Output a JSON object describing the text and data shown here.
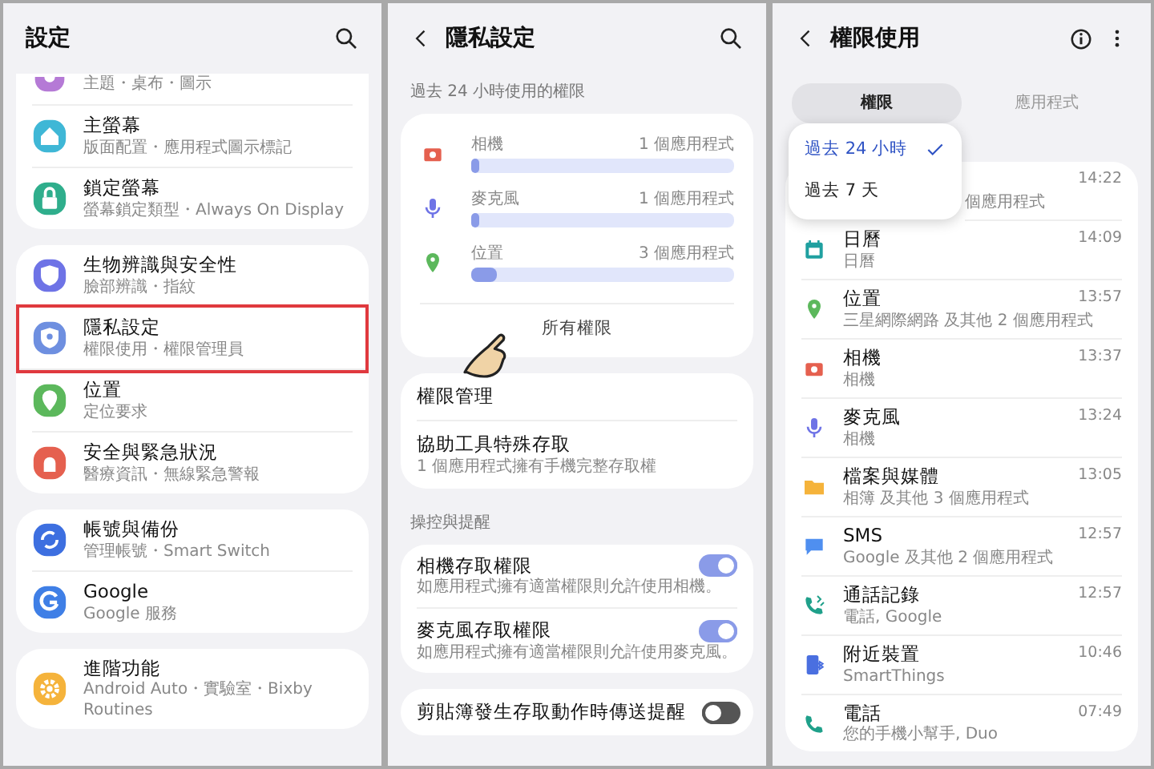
{
  "screens": [
    {
      "kind": "settings",
      "title": "設定",
      "groups": [
        {
          "items": [
            {
              "subtitle": "主題・桌布・圖示",
              "color": "#b57ad6",
              "highlighted": false
            },
            {
              "title": "主螢幕",
              "subtitle": "版面配置・應用程式圖示標記",
              "color": "#3fb7d6",
              "highlighted": false
            },
            {
              "title": "鎖定螢幕",
              "subtitle": "螢幕鎖定類型・Always On Display",
              "color": "#2fae8c",
              "highlighted": false
            }
          ]
        },
        {
          "items": [
            {
              "title": "生物辨識與安全性",
              "subtitle": "臉部辨識・指紋",
              "color": "#6e73e6",
              "highlighted": false
            },
            {
              "title": "隱私設定",
              "subtitle": "權限使用・權限管理員",
              "color": "#6e8fe0",
              "highlighted": true
            },
            {
              "title": "位置",
              "subtitle": "定位要求",
              "color": "#5cb85c",
              "highlighted": false
            },
            {
              "title": "安全與緊急狀況",
              "subtitle": "醫療資訊・無線緊急警報",
              "color": "#e5604f",
              "highlighted": false
            }
          ]
        },
        {
          "items": [
            {
              "title": "帳號與備份",
              "subtitle": "管理帳號・Smart Switch",
              "color": "#3d6fe0",
              "highlighted": false
            },
            {
              "title": "Google",
              "subtitle": "Google 服務",
              "color": "#3f7fe6",
              "highlighted": false
            }
          ]
        },
        {
          "items": [
            {
              "title": "進階功能",
              "subtitle": "Android Auto・實驗室・Bixby Routines",
              "color": "#f5b33b",
              "highlighted": false
            }
          ]
        }
      ]
    },
    {
      "kind": "privacy",
      "title": "隱私設定",
      "usage_label": "過去 24 小時使用的權限",
      "usage": [
        {
          "name": "相機",
          "count": "1 個應用程式",
          "level": 0.03,
          "color": "#e5604f"
        },
        {
          "name": "麥克風",
          "count": "1 個應用程式",
          "level": 0.03,
          "color": "#6e73e6"
        },
        {
          "name": "位置",
          "count": "3 個應用程式",
          "level": 0.1,
          "color": "#5cb85c"
        }
      ],
      "all_link": "所有權限",
      "manage_items": [
        {
          "title": "權限管理"
        },
        {
          "title": "協助工具特殊存取",
          "subtitle": "1 個應用程式擁有手機完整存取權"
        }
      ],
      "section_label": "操控與提醒",
      "toggles": [
        {
          "title": "相機存取權限",
          "subtitle": "如應用程式擁有適當權限則允許使用相機。",
          "on": true
        },
        {
          "title": "麥克風存取權限",
          "subtitle": "如應用程式擁有適當權限則允許使用麥克風。",
          "on": true
        }
      ],
      "last_toggle": {
        "title": "剪貼簿發生存取動作時傳送提醒",
        "on": false
      }
    },
    {
      "kind": "usage",
      "title": "權限使用",
      "tabs": [
        {
          "label": "權限",
          "selected": true
        },
        {
          "label": "應用程式",
          "selected": false
        }
      ],
      "menu": [
        {
          "label": "過去 24 小時",
          "selected": true
        },
        {
          "label": "過去 7 天",
          "selected": false
        }
      ],
      "rows": [
        {
          "subtitle": "個應用程式",
          "time": "14:22"
        },
        {
          "title": "日曆",
          "subtitle": "日曆",
          "time": "14:09",
          "color": "#1fa0a0"
        },
        {
          "title": "位置",
          "subtitle": "三星網際網路 及其他 2 個應用程式",
          "time": "13:57",
          "color": "#5cb85c"
        },
        {
          "title": "相機",
          "subtitle": "相機",
          "time": "13:37",
          "color": "#e5604f"
        },
        {
          "title": "麥克風",
          "subtitle": "相機",
          "time": "13:24",
          "color": "#6e73e6"
        },
        {
          "title": "檔案與媒體",
          "subtitle": "相簿 及其他 3 個應用程式",
          "time": "13:05",
          "color": "#f5b33b"
        },
        {
          "title": "SMS",
          "subtitle": "Google 及其他 2 個應用程式",
          "time": "12:57",
          "color": "#4f8ff0"
        },
        {
          "title": "通話記錄",
          "subtitle": "電話, Google",
          "time": "12:57",
          "color": "#1fa08a"
        },
        {
          "title": "附近裝置",
          "subtitle": "SmartThings",
          "time": "10:46",
          "color": "#4a6fe0"
        },
        {
          "title": "電話",
          "subtitle": "您的手機小幫手, Duo",
          "time": "07:49",
          "color": "#1fa08a"
        }
      ]
    }
  ]
}
